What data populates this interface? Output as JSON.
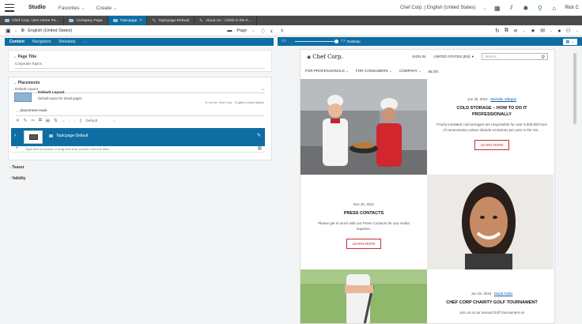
{
  "topbar": {
    "title": "Studio",
    "menu": [
      "Favorites",
      "Create"
    ],
    "site": "Chef Corp. | English (United States)",
    "user": "Rick C"
  },
  "tabs": [
    {
      "label": "Chef Corp. USA Home Pa...",
      "active": false,
      "icon": "page"
    },
    {
      "label": "Company Page",
      "active": false,
      "icon": "page"
    },
    {
      "label": "Topicpage",
      "active": true,
      "icon": "page"
    },
    {
      "label": "Topicpage-Default",
      "active": false,
      "icon": "pen"
    },
    {
      "label": "About Us - Chefs in the K...",
      "active": false,
      "icon": "pen"
    }
  ],
  "left_toolbar": {
    "locale": "English (United States)",
    "type": "Page"
  },
  "content_tabs": [
    "Content",
    "Navigation",
    "Metadata",
    "···"
  ],
  "page_title": {
    "label": "Page Title",
    "value": "Corporate Topics"
  },
  "placements": {
    "label": "Placements",
    "layout_select": "Default Layout",
    "layout_name": "Default Layout",
    "layout_desc": "Default layout for detail pages.",
    "inherit_note": "To me.me. Chef Corp. · English (United States)",
    "main_label": "placement-main",
    "tile_label": "Topicpage-Default",
    "view_select": "Default",
    "drop_hint": "Type here to search or drag and drop content onto this area."
  },
  "sections": [
    "Teaser",
    "Validity"
  ],
  "preview_toolbar": {
    "device": "Desktop"
  },
  "preview": {
    "logo": "Chef Corp.",
    "sign_in": "SIGN IN",
    "region": "UNITED STATES (EN)",
    "search_placeholder": "Search...",
    "menu": [
      "FOR PROFESSIONALS",
      "FOR CONSUMERS",
      "COMPANY",
      "BLOG"
    ],
    "cards": [
      {
        "date": "Jun 26, 2019",
        "author": "Michelle Villegas",
        "title": "COLD STORAGE – HOW TO DO IT PROFESSIONALLY",
        "desc": "Poorly insulated cold storages are responsible for over 5,000,000 tons of unnecessary carbon dioxide emissions per year in the US...",
        "button": "LEARN MORE"
      },
      {
        "date": "Nov 30, 2021",
        "title": "PRESS CONTACTS",
        "desc": "Please get in touch with our Press Contacts for any media inquiries.",
        "button": "LEARN MORE"
      },
      {
        "date": "Jun 26, 2019",
        "author": "David Fuller",
        "title": "CHEF CORP CHARITY GOLF TOURNAMENT",
        "desc": "Join us at our annual Golf Tournament on"
      }
    ]
  },
  "colors": {
    "accent": "#0e6ea3",
    "tabbar": "#4b4b4b",
    "button_red": "#c7303a"
  }
}
